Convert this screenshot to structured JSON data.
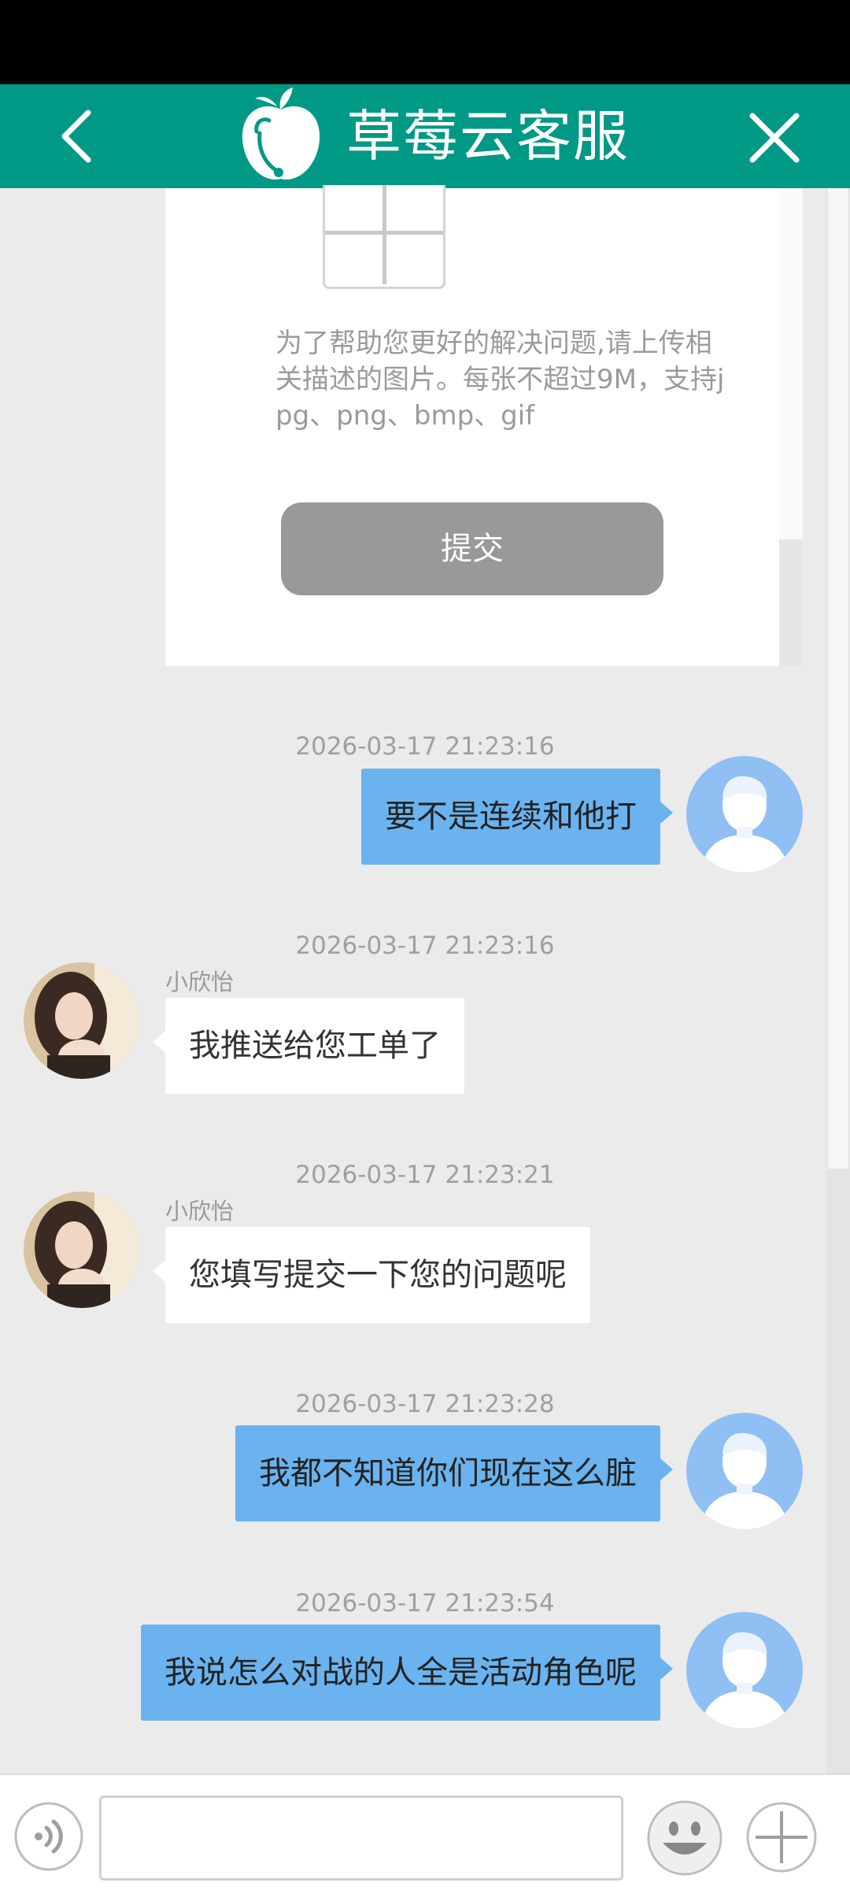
{
  "header": {
    "title": "草莓云客服",
    "back_icon": "chevron-left-icon",
    "close_icon": "close-icon",
    "logo_icon": "strawberry-headset-logo",
    "bg_color": "#009985"
  },
  "form": {
    "upload_hint": "为了帮助您更好的解决问题,请上传相关描述的图片。每张不超过9M，支持jpg、png、bmp、gif",
    "submit_label": "提交"
  },
  "messages": [
    {
      "time": "2026-03-17 21:23:16",
      "side": "right",
      "text": "要不是连续和他打"
    },
    {
      "time": "2026-03-17 21:23:16",
      "side": "left",
      "sender": "小欣怡",
      "text": "我推送给您工单了"
    },
    {
      "time": "2026-03-17 21:23:21",
      "side": "left",
      "sender": "小欣怡",
      "text": "您填写提交一下您的问题呢"
    },
    {
      "time": "2026-03-17 21:23:28",
      "side": "right",
      "text": "我都不知道你们现在这么脏"
    },
    {
      "time": "2026-03-17 21:23:54",
      "side": "right",
      "text": "我说怎么对战的人全是活动角色呢"
    }
  ],
  "input_bar": {
    "placeholder": "",
    "voice_icon": "voice-icon",
    "emoji_icon": "emoji-icon",
    "plus_icon": "plus-icon"
  },
  "colors": {
    "user_bubble": "#6ab3ef",
    "agent_bubble": "#ffffff",
    "background": "#ebebeb"
  }
}
